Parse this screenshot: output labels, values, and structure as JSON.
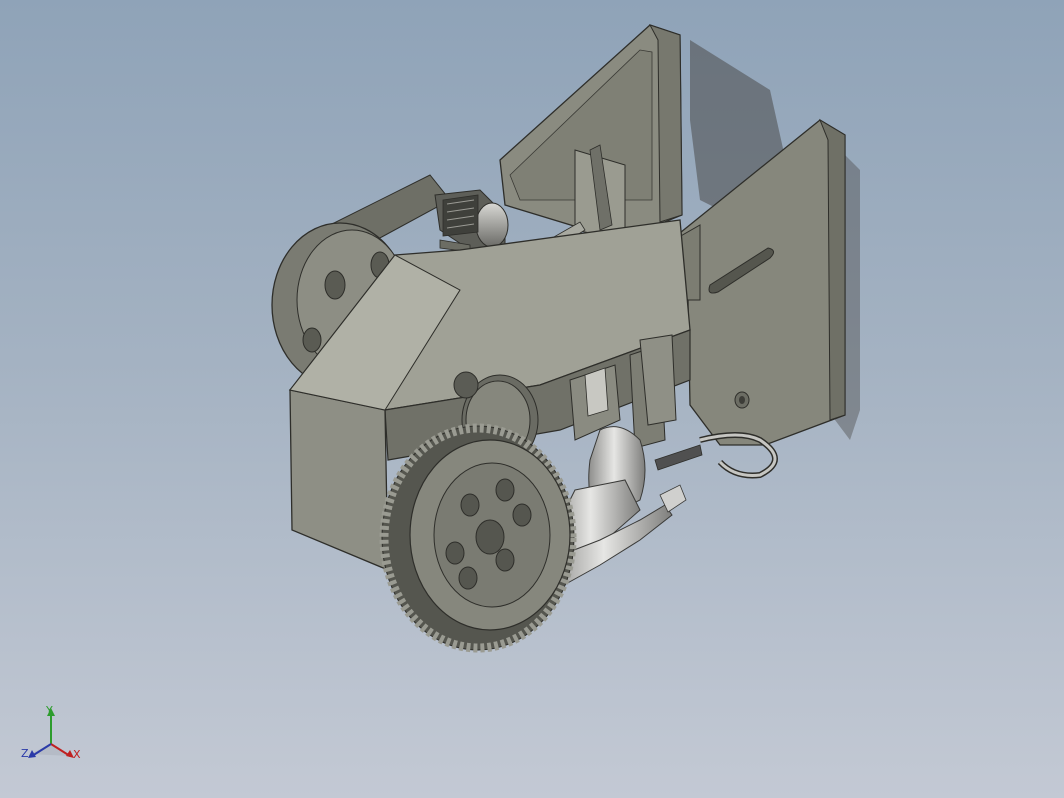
{
  "viewport": {
    "background_top": "#8fa3b8",
    "background_bottom": "#c3c9d4"
  },
  "model": {
    "body_color": "#8a8b80",
    "gear_color": "#7c7d74",
    "plate_color": "#86877c",
    "limb_color": "#b8b8b6"
  },
  "triad": {
    "x_label": "X",
    "y_label": "Y",
    "z_label": "Z",
    "x_color": "#c02020",
    "y_color": "#2d9c2d",
    "z_color": "#2a3aa8"
  }
}
